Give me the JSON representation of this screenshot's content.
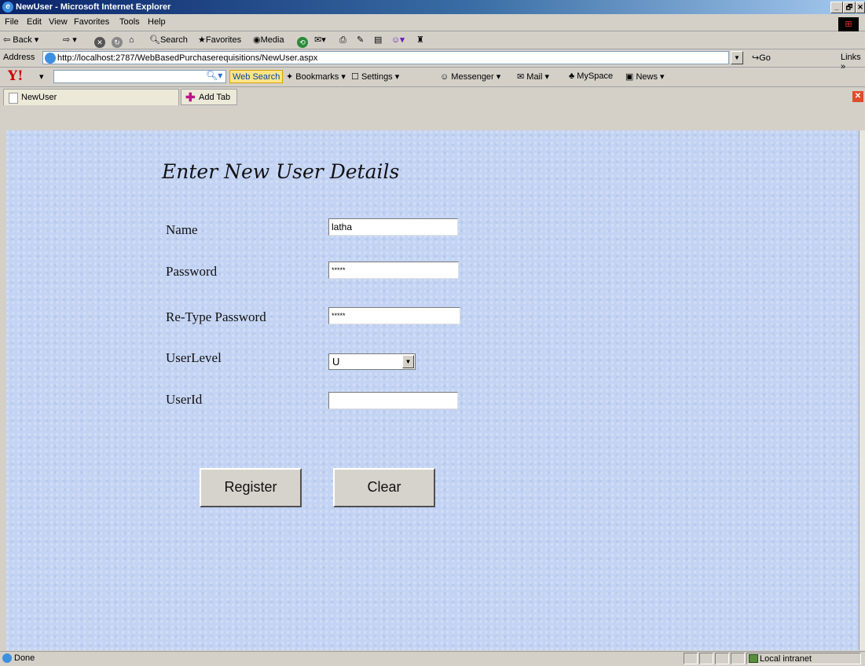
{
  "window": {
    "title": "NewUser - Microsoft Internet Explorer",
    "controls": [
      "_",
      "🗗",
      "✕"
    ]
  },
  "menubar": {
    "items": [
      "File",
      "Edit",
      "View",
      "Favorites",
      "Tools",
      "Help"
    ]
  },
  "toolbar": {
    "back": "Back",
    "search": "Search",
    "favorites": "Favorites",
    "media": "Media"
  },
  "addressbar": {
    "label": "Address",
    "url": "http://localhost:2787/WebBasedPurchaserequisitions/NewUser.aspx",
    "go": "Go",
    "links": "Links"
  },
  "yahoo_toolbar": {
    "logo": "Y!",
    "web_search": "Web Search",
    "bookmarks": "Bookmarks",
    "settings": "Settings",
    "messenger": "Messenger",
    "mail": "Mail",
    "myspace": "MySpace",
    "news": "News"
  },
  "tabs": {
    "active": "NewUser",
    "add_tab": "Add Tab"
  },
  "form": {
    "heading": "Enter New User Details",
    "name_label": "Name",
    "name_value": "latha",
    "password_label": "Password",
    "password_value": "*****",
    "retype_label": "Re-Type Password",
    "retype_value": "*****",
    "userlevel_label": "UserLevel",
    "userlevel_value": "U",
    "userid_label": "UserId",
    "userid_value": "",
    "register_button": "Register",
    "clear_button": "Clear"
  },
  "statusbar": {
    "status": "Done",
    "zone": "Local intranet"
  }
}
